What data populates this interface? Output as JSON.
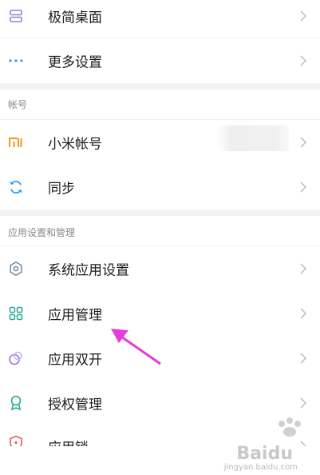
{
  "colors": {
    "purple": "#9a7bd6",
    "teal": "#27a79a",
    "orange": "#f39a1b",
    "blue": "#2f9ee8",
    "magenta": "#e83bd9"
  },
  "top_rows": [
    {
      "label": "极简桌面",
      "icon": "stack-icon"
    },
    {
      "label": "更多设置",
      "icon": "more-dots-icon"
    }
  ],
  "account_section": {
    "title": "帐号",
    "rows": [
      {
        "label": "小米帐号",
        "icon": "mi-logo-icon"
      },
      {
        "label": "同步",
        "icon": "sync-icon"
      }
    ]
  },
  "app_section": {
    "title": "应用设置和管理",
    "rows": [
      {
        "label": "系统应用设置",
        "icon": "gear-icon"
      },
      {
        "label": "应用管理",
        "icon": "grid-icon"
      },
      {
        "label": "应用双开",
        "icon": "dual-circle-icon"
      },
      {
        "label": "授权管理",
        "icon": "ribbon-icon"
      },
      {
        "label": "应用锁",
        "icon": "shield-icon"
      }
    ]
  },
  "watermark": {
    "brand": "Baidu",
    "sub": "jingyan.baidu.com"
  }
}
